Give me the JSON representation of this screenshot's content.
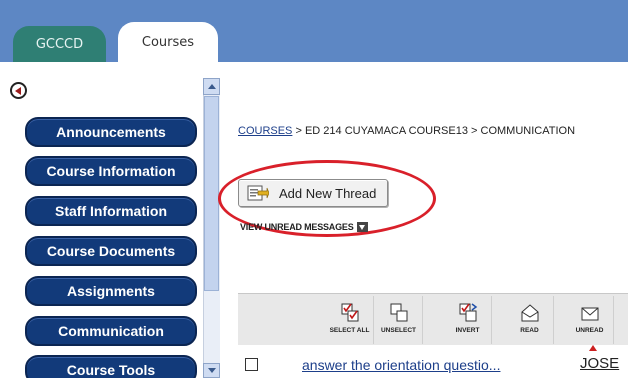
{
  "tabs": [
    {
      "label": "GCCCD",
      "active": false
    },
    {
      "label": "Courses",
      "active": true
    }
  ],
  "sidebar": {
    "items": [
      {
        "label": "Announcements"
      },
      {
        "label": "Course Information"
      },
      {
        "label": "Staff Information"
      },
      {
        "label": "Course Documents"
      },
      {
        "label": "Assignments"
      },
      {
        "label": "Communication"
      },
      {
        "label": "Course Tools"
      }
    ]
  },
  "breadcrumb": {
    "root": "COURSES",
    "rest": " > ED 214 CUYAMACA COURSE13 > COMMUNICATION"
  },
  "main": {
    "add_thread_label": "Add New Thread",
    "view_unread_label": "VIEW UNREAD MESSAGES"
  },
  "toolbar": {
    "select_all": "SELECT ALL",
    "unselect": "UNSELECT",
    "invert": "INVERT",
    "read": "READ",
    "unread": "UNREAD"
  },
  "thread": {
    "title": "answer the orientation questio...",
    "author": "JOSE"
  },
  "colors": {
    "topbar": "#5d87c4",
    "inactive_tab": "#2f7f74",
    "nav_button": "#123a7a",
    "highlight": "#d9202a",
    "link": "#1d3f8a"
  }
}
